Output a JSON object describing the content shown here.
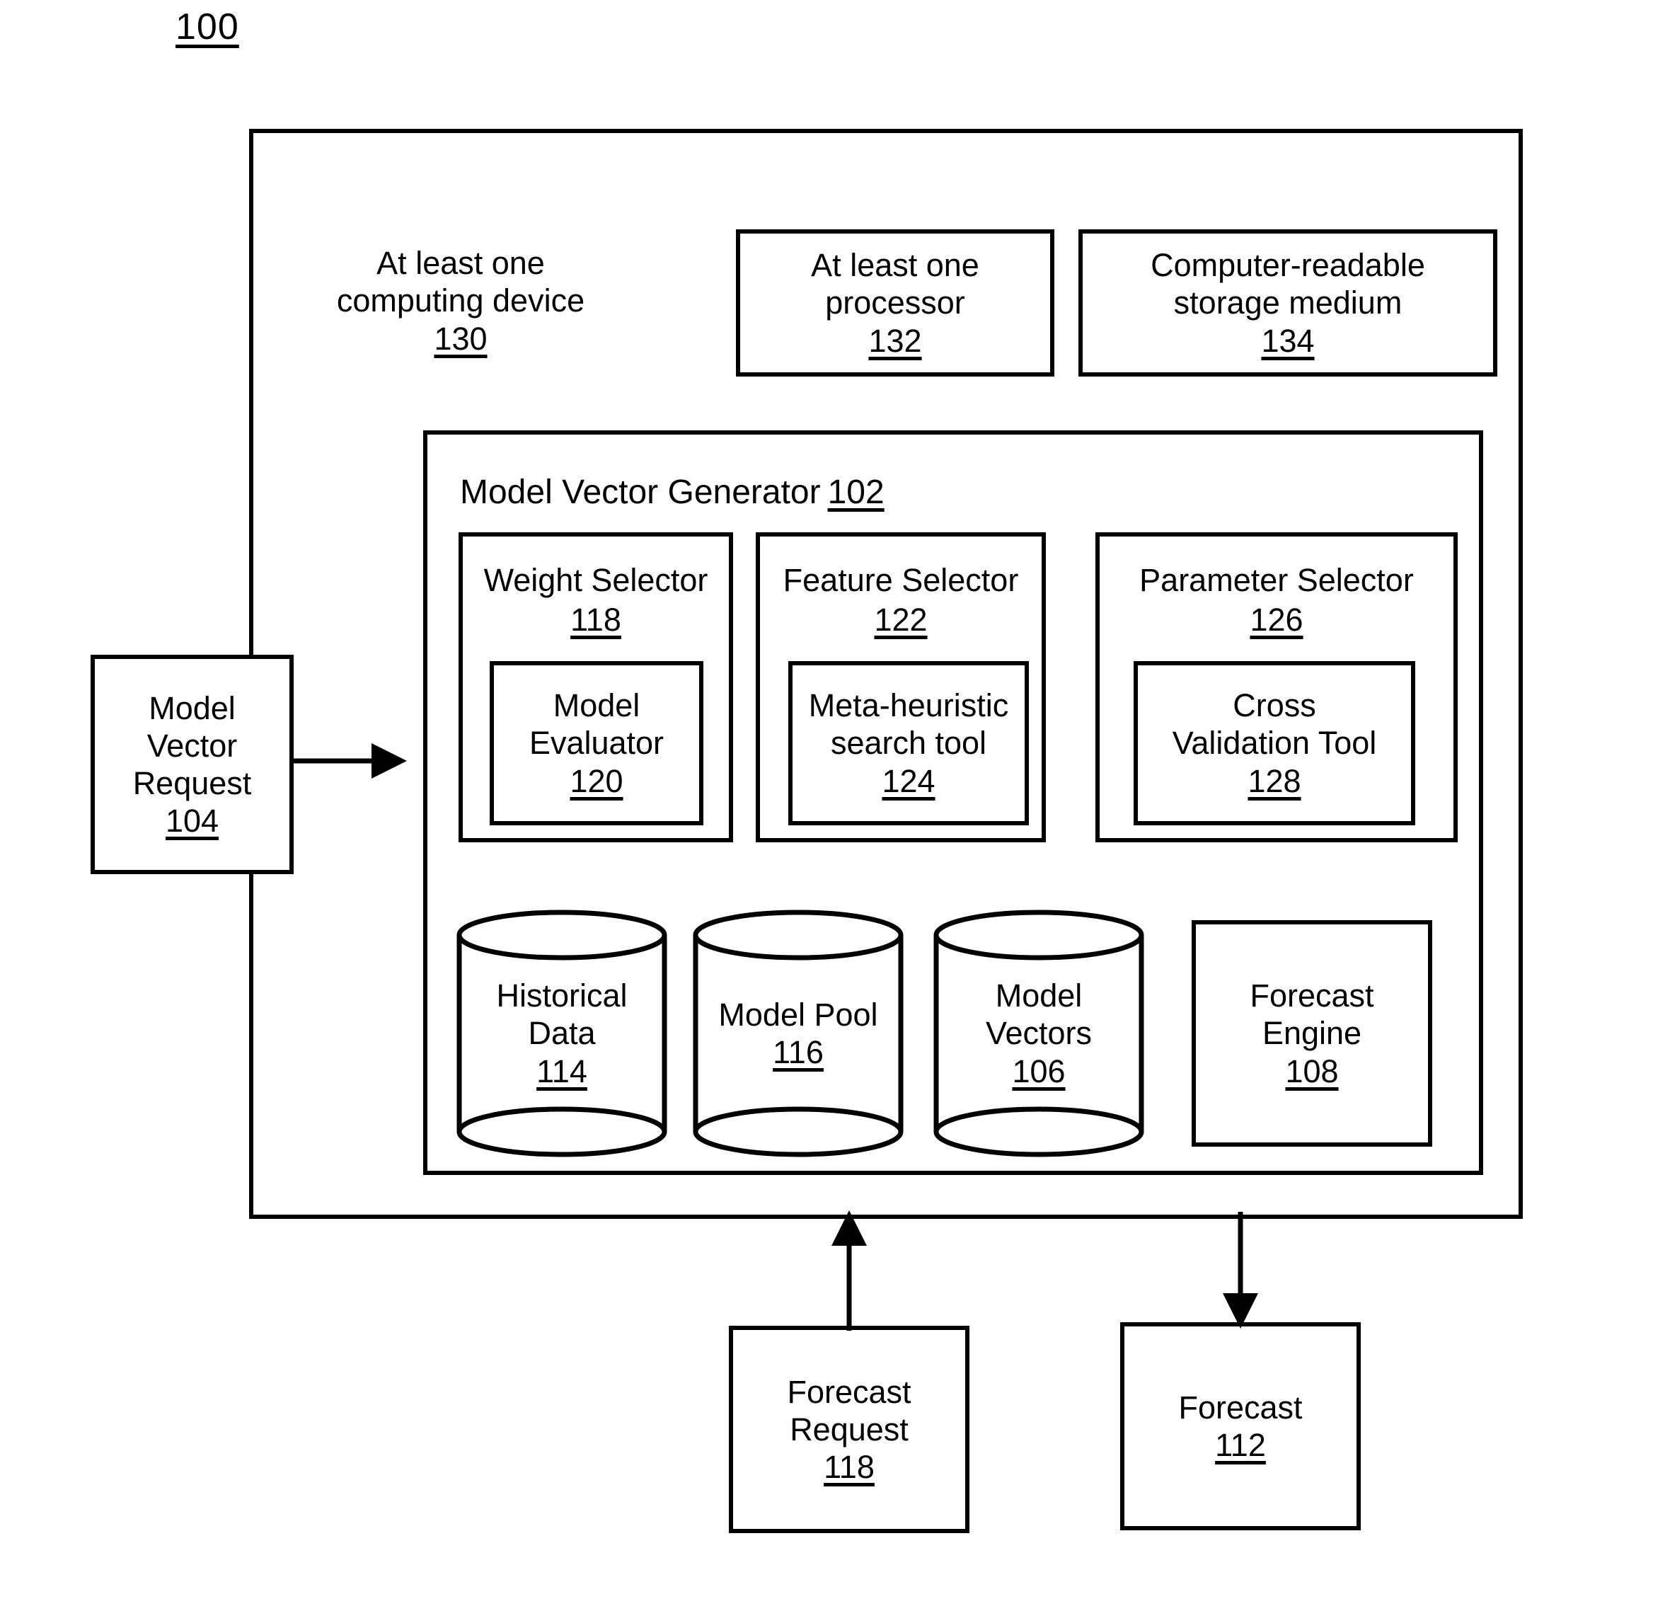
{
  "figure": {
    "number": "100"
  },
  "system": {
    "computing_device": {
      "line1": "At least one",
      "line2": "computing device",
      "ref": "130"
    },
    "processor": {
      "line1": "At least one",
      "line2": "processor",
      "ref": "132"
    },
    "storage_medium": {
      "line1": "Computer-readable",
      "line2": "storage medium",
      "ref": "134"
    }
  },
  "model_vector_generator": {
    "title": "Model Vector Generator",
    "ref": "102",
    "selectors": [
      {
        "label": "Weight Selector",
        "ref": "118",
        "inner": {
          "line1": "Model",
          "line2": "Evaluator",
          "ref": "120"
        }
      },
      {
        "label": "Feature Selector",
        "ref": "122",
        "inner": {
          "line1": "Meta-heuristic",
          "line2": "search tool",
          "ref": "124"
        }
      },
      {
        "label": "Parameter Selector",
        "ref": "126",
        "inner": {
          "line1": "Cross",
          "line2": "Validation Tool",
          "ref": "128"
        }
      }
    ],
    "stores": [
      {
        "line1": "Historical",
        "line2": "Data",
        "ref": "114",
        "shape": "cylinder"
      },
      {
        "line1": "Model Pool",
        "line2": "",
        "ref": "116",
        "shape": "cylinder"
      },
      {
        "line1": "Model",
        "line2": "Vectors",
        "ref": "106",
        "shape": "cylinder"
      },
      {
        "line1": "Forecast",
        "line2": "Engine",
        "ref": "108",
        "shape": "rectangle"
      }
    ]
  },
  "external": {
    "model_vector_request": {
      "line1": "Model",
      "line2": "Vector",
      "line3": "Request",
      "ref": "104"
    },
    "forecast_request": {
      "line1": "Forecast",
      "line2": "Request",
      "ref": "118"
    },
    "forecast": {
      "line1": "Forecast",
      "line2": "",
      "ref": "112"
    }
  },
  "arrows": [
    {
      "name": "request-into-system",
      "direction": "right"
    },
    {
      "name": "forecast-request-into-system",
      "direction": "up"
    },
    {
      "name": "forecast-out-of-system",
      "direction": "down"
    }
  ],
  "colors": {
    "stroke": "#000000",
    "background": "#ffffff"
  }
}
